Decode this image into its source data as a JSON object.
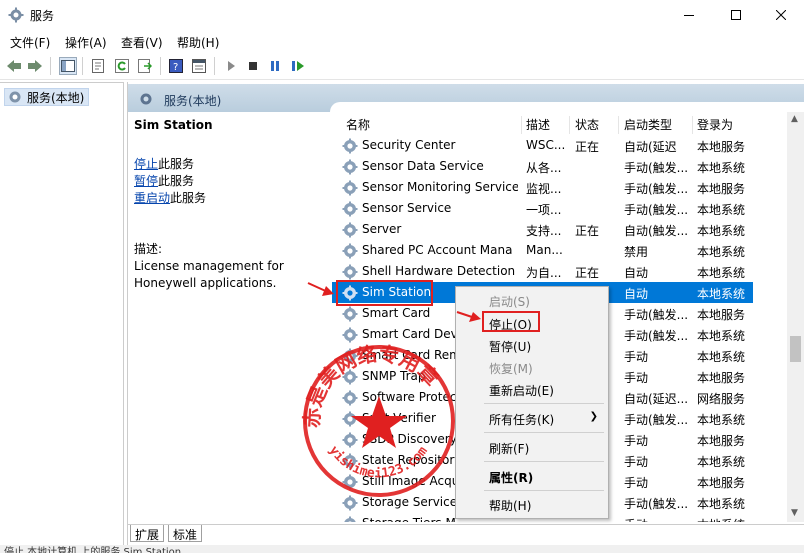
{
  "window": {
    "title": "服务",
    "controls": {
      "minimize": "minimize",
      "maximize": "maximize",
      "close": "close"
    }
  },
  "menubar": {
    "items": [
      "文件(F)",
      "操作(A)",
      "查看(V)",
      "帮助(H)"
    ]
  },
  "toolbar": {
    "icons": [
      "back-icon",
      "forward-icon",
      "show-tree-icon",
      "properties-icon",
      "refresh-icon",
      "export-icon",
      "help-icon",
      "console-icon",
      "start-service-icon",
      "stop-service-icon",
      "pause-service-icon",
      "restart-service-icon"
    ]
  },
  "tree": {
    "root_label": "服务(本地)"
  },
  "pane": {
    "header_title": "服务(本地)",
    "selected_service": "Sim Station",
    "actions": [
      {
        "link": "停止",
        "suffix": "此服务"
      },
      {
        "link": "暂停",
        "suffix": "此服务"
      },
      {
        "link": "重启动",
        "suffix": "此服务"
      }
    ],
    "description_label": "描述:",
    "description_text": "License management for Honeywell applications."
  },
  "list": {
    "columns": [
      "名称",
      "描述",
      "状态",
      "启动类型",
      "登录为"
    ],
    "rows": [
      {
        "name": "Security Center",
        "desc": "WSC...",
        "status": "正在",
        "startup": "自动(延迟",
        "logon": "本地服务"
      },
      {
        "name": "Sensor Data Service",
        "desc": "从各...",
        "status": "",
        "startup": "手动(触发...",
        "logon": "本地系统"
      },
      {
        "name": "Sensor Monitoring Service",
        "desc": "监视...",
        "status": "",
        "startup": "手动(触发...",
        "logon": "本地服务"
      },
      {
        "name": "Sensor Service",
        "desc": "一项...",
        "status": "",
        "startup": "手动(触发...",
        "logon": "本地系统"
      },
      {
        "name": "Server",
        "desc": "支持...",
        "status": "正在",
        "startup": "自动(触发...",
        "logon": "本地系统"
      },
      {
        "name": "Shared PC Account Mana",
        "desc": "Man...",
        "status": "",
        "startup": "禁用",
        "logon": "本地系统"
      },
      {
        "name": "Shell Hardware Detection",
        "desc": "为自...",
        "status": "正在",
        "startup": "自动",
        "logon": "本地系统"
      },
      {
        "name": "Sim Station",
        "desc": "",
        "status": "",
        "startup": "自动",
        "logon": "本地系统"
      },
      {
        "name": "Smart Card",
        "desc": "",
        "status": "",
        "startup": "手动(触发...",
        "logon": "本地服务"
      },
      {
        "name": "Smart Card Dev",
        "desc": "",
        "status": "",
        "startup": "手动(触发...",
        "logon": "本地系统"
      },
      {
        "name": "Smart Card Rem",
        "desc": "",
        "status": "",
        "startup": "手动",
        "logon": "本地系统"
      },
      {
        "name": "SNMP Trap",
        "desc": "",
        "status": "",
        "startup": "手动",
        "logon": "本地服务"
      },
      {
        "name": "Software Protect",
        "desc": "",
        "status": "",
        "startup": "自动(延迟...",
        "logon": "网络服务"
      },
      {
        "name": "Spot Verifier",
        "desc": "",
        "status": "",
        "startup": "手动(触发...",
        "logon": "本地系统"
      },
      {
        "name": "SSDP Discovery",
        "desc": "",
        "status": "",
        "startup": "手动",
        "logon": "本地服务"
      },
      {
        "name": "State Repository",
        "desc": "",
        "status": "",
        "startup": "手动",
        "logon": "本地系统"
      },
      {
        "name": "Still Image Acqu",
        "desc": "",
        "status": "",
        "startup": "手动",
        "logon": "本地服务"
      },
      {
        "name": "Storage Service",
        "desc": "",
        "status": "",
        "startup": "手动(触发...",
        "logon": "本地系统"
      },
      {
        "name": "Storage Tiers M",
        "desc": "",
        "status": "",
        "startup": "手动",
        "logon": "本地系统"
      }
    ]
  },
  "context_menu": {
    "items": [
      {
        "label": "启动(S)",
        "enabled": false
      },
      {
        "label": "停止(O)",
        "enabled": true
      },
      {
        "label": "暂停(U)",
        "enabled": true
      },
      {
        "label": "恢复(M)",
        "enabled": false
      },
      {
        "label": "重新启动(E)",
        "enabled": true
      },
      {
        "label": "所有任务(K)",
        "enabled": true,
        "submenu": true
      },
      {
        "label": "刷新(F)",
        "enabled": true
      },
      {
        "label": "属性(R)",
        "enabled": true,
        "bold": true
      },
      {
        "label": "帮助(H)",
        "enabled": true
      }
    ]
  },
  "tabs": [
    "扩展",
    "标准"
  ],
  "statusbar": {
    "text": "停止 本地计算机 上的服务 Sim Station"
  },
  "watermark": {
    "text": "赤是美网络专用章",
    "url": "yishimei123.com"
  },
  "colors": {
    "selection": "#0078d7",
    "annotation": "#e02020",
    "link": "#0645ad",
    "header_gradient_top": "#cfdde9",
    "header_gradient_bottom": "#b9cddd"
  }
}
